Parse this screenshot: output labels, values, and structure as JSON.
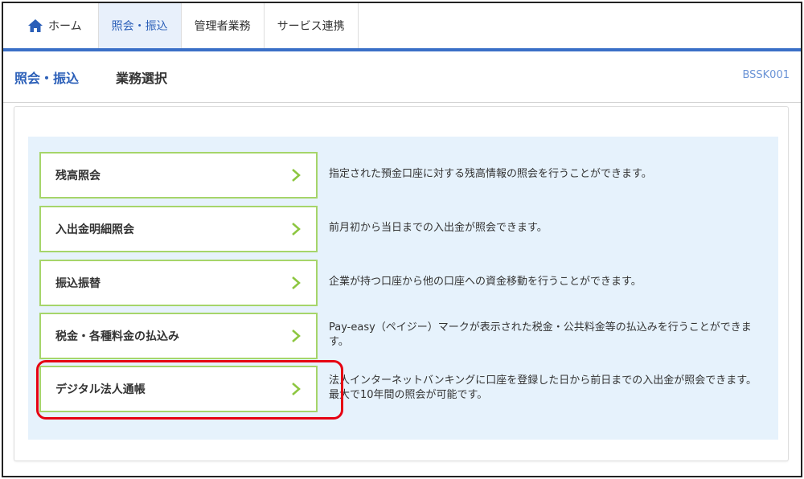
{
  "nav": {
    "home": "ホーム",
    "items": [
      "照会・振込",
      "管理者業務",
      "サービス連携"
    ],
    "active_index": 0
  },
  "header": {
    "category": "照会・振込",
    "title": "業務選択",
    "code": "BSSK001"
  },
  "menu": [
    {
      "label": "残高照会",
      "desc": "指定された預金口座に対する残高情報の照会を行うことができます。"
    },
    {
      "label": "入出金明細照会",
      "desc": "前月初から当日までの入出金が照会できます。"
    },
    {
      "label": "振込振替",
      "desc": "企業が持つ口座から他の口座への資金移動を行うことができます。"
    },
    {
      "label": "税金・各種料金の払込み",
      "desc": "Pay-easy（ペイジー）マークが表示された税金・公共料金等の払込みを行うことができます。"
    },
    {
      "label": "デジタル法人通帳",
      "desc": "法人インターネットバンキングに口座を登録した日から前日までの入出金が照会できます。最大で10年間の照会が可能です。"
    }
  ],
  "colors": {
    "nav_bar": "#3a6fc7",
    "accent_blue": "#2b5fb8",
    "menu_border": "#a6d56a",
    "chevron": "#8cc63f",
    "highlight": "#e60012",
    "menu_bg": "#e6f2fc"
  },
  "icons": {
    "home": "home-icon",
    "chevron": "chevron-right-icon"
  }
}
